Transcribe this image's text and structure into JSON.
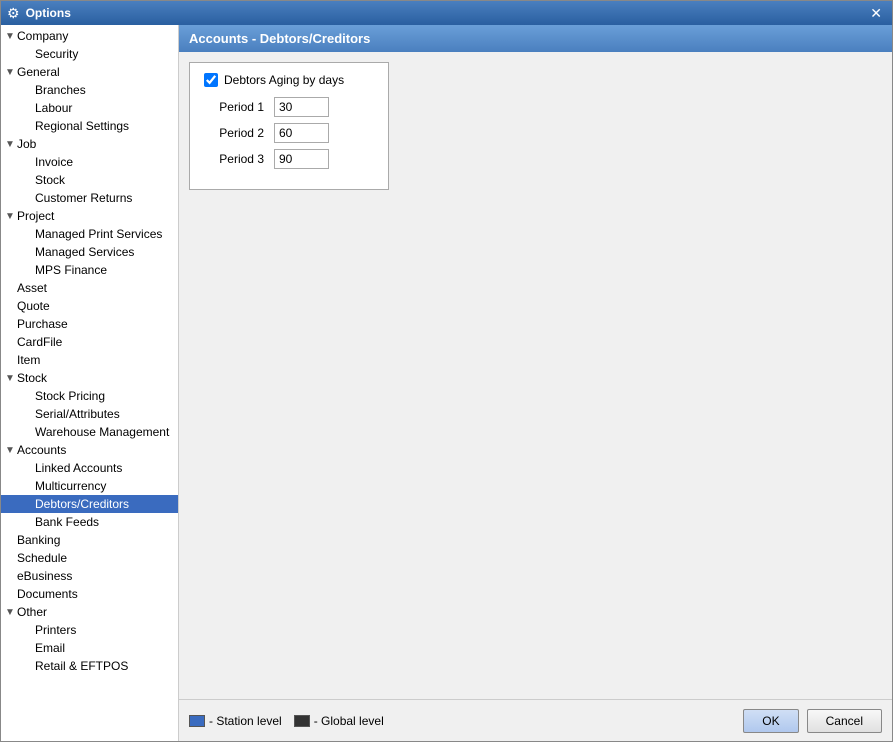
{
  "window": {
    "title": "Options",
    "close_label": "✕",
    "icon": "⚙"
  },
  "panel": {
    "header": "Accounts - Debtors/Creditors"
  },
  "form": {
    "checkbox_label": "Debtors Aging by days",
    "checkbox_checked": true,
    "period1_label": "Period 1",
    "period1_value": "30",
    "period2_label": "Period 2",
    "period2_value": "60",
    "period3_label": "Period 3",
    "period3_value": "90"
  },
  "footer": {
    "legend_station": "- Station level",
    "legend_global": "- Global level",
    "ok_label": "OK",
    "cancel_label": "Cancel"
  },
  "sidebar": {
    "items": [
      {
        "id": "company",
        "label": "Company",
        "level": 0,
        "toggle": "▼",
        "selected": false
      },
      {
        "id": "security",
        "label": "Security",
        "level": 1,
        "toggle": "",
        "selected": false
      },
      {
        "id": "general",
        "label": "General",
        "level": 0,
        "toggle": "▼",
        "selected": false
      },
      {
        "id": "branches",
        "label": "Branches",
        "level": 1,
        "toggle": "",
        "selected": false
      },
      {
        "id": "labour",
        "label": "Labour",
        "level": 1,
        "toggle": "",
        "selected": false
      },
      {
        "id": "regional-settings",
        "label": "Regional Settings",
        "level": 1,
        "toggle": "",
        "selected": false
      },
      {
        "id": "job",
        "label": "Job",
        "level": 0,
        "toggle": "▼",
        "selected": false
      },
      {
        "id": "invoice",
        "label": "Invoice",
        "level": 1,
        "toggle": "",
        "selected": false
      },
      {
        "id": "stock-job",
        "label": "Stock",
        "level": 1,
        "toggle": "",
        "selected": false
      },
      {
        "id": "customer-returns",
        "label": "Customer Returns",
        "level": 1,
        "toggle": "",
        "selected": false
      },
      {
        "id": "project",
        "label": "Project",
        "level": 0,
        "toggle": "▼",
        "selected": false
      },
      {
        "id": "managed-print-services",
        "label": "Managed Print Services",
        "level": 1,
        "toggle": "",
        "selected": false
      },
      {
        "id": "managed-services",
        "label": "Managed Services",
        "level": 1,
        "toggle": "",
        "selected": false
      },
      {
        "id": "mps-finance",
        "label": "MPS Finance",
        "level": 1,
        "toggle": "",
        "selected": false
      },
      {
        "id": "asset",
        "label": "Asset",
        "level": 0,
        "toggle": "",
        "selected": false
      },
      {
        "id": "quote",
        "label": "Quote",
        "level": 0,
        "toggle": "",
        "selected": false
      },
      {
        "id": "purchase",
        "label": "Purchase",
        "level": 0,
        "toggle": "",
        "selected": false
      },
      {
        "id": "cardfile",
        "label": "CardFile",
        "level": 0,
        "toggle": "",
        "selected": false
      },
      {
        "id": "item",
        "label": "Item",
        "level": 0,
        "toggle": "",
        "selected": false
      },
      {
        "id": "stock",
        "label": "Stock",
        "level": 0,
        "toggle": "▼",
        "selected": false
      },
      {
        "id": "stock-pricing",
        "label": "Stock Pricing",
        "level": 1,
        "toggle": "",
        "selected": false
      },
      {
        "id": "serial-attributes",
        "label": "Serial/Attributes",
        "level": 1,
        "toggle": "",
        "selected": false
      },
      {
        "id": "warehouse-management",
        "label": "Warehouse Management",
        "level": 1,
        "toggle": "",
        "selected": false
      },
      {
        "id": "accounts",
        "label": "Accounts",
        "level": 0,
        "toggle": "▼",
        "selected": false
      },
      {
        "id": "linked-accounts",
        "label": "Linked Accounts",
        "level": 1,
        "toggle": "",
        "selected": false
      },
      {
        "id": "multicurrency",
        "label": "Multicurrency",
        "level": 1,
        "toggle": "",
        "selected": false
      },
      {
        "id": "debtors-creditors",
        "label": "Debtors/Creditors",
        "level": 1,
        "toggle": "",
        "selected": true
      },
      {
        "id": "bank-feeds",
        "label": "Bank Feeds",
        "level": 1,
        "toggle": "",
        "selected": false
      },
      {
        "id": "banking",
        "label": "Banking",
        "level": 0,
        "toggle": "",
        "selected": false
      },
      {
        "id": "schedule",
        "label": "Schedule",
        "level": 0,
        "toggle": "",
        "selected": false
      },
      {
        "id": "ebusiness",
        "label": "eBusiness",
        "level": 0,
        "toggle": "",
        "selected": false
      },
      {
        "id": "documents",
        "label": "Documents",
        "level": 0,
        "toggle": "",
        "selected": false
      },
      {
        "id": "other",
        "label": "Other",
        "level": 0,
        "toggle": "▼",
        "selected": false
      },
      {
        "id": "printers",
        "label": "Printers",
        "level": 1,
        "toggle": "",
        "selected": false
      },
      {
        "id": "email",
        "label": "Email",
        "level": 1,
        "toggle": "",
        "selected": false
      },
      {
        "id": "retail-eftpos",
        "label": "Retail & EFTPOS",
        "level": 1,
        "toggle": "",
        "selected": false
      }
    ]
  }
}
